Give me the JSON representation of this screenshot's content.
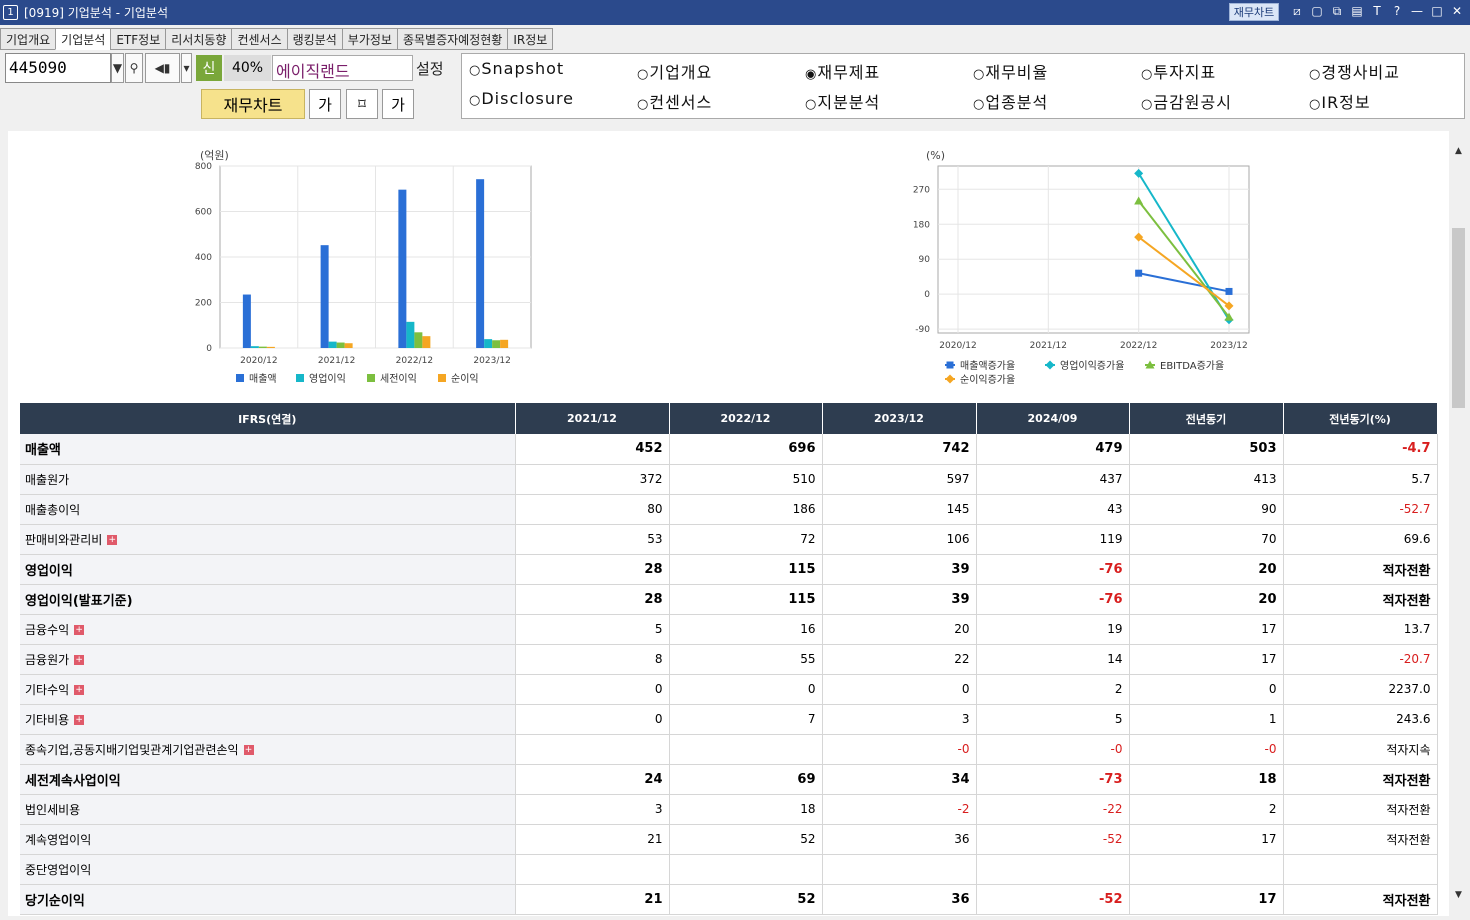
{
  "window": {
    "number": "1",
    "title": "[0919] 기업분석 - 기업분석",
    "fin_chart_btn": "재무차트"
  },
  "title_icons": [
    "chart-icon",
    "window-icon",
    "restore-icon",
    "tile-icon",
    "font-icon",
    "help-icon",
    "minimize-icon",
    "maximize-icon",
    "close-icon"
  ],
  "title_icon_glyphs": [
    "⧄",
    "▢",
    "⧉",
    "▤",
    "T",
    "?",
    "—",
    "□",
    "✕"
  ],
  "tabs": [
    "기업개요",
    "기업분석",
    "ETF정보",
    "리서치동향",
    "컨센서스",
    "랭킹분석",
    "부가정보",
    "종목별증자예정현황",
    "IR정보"
  ],
  "active_tab": 1,
  "toolbar": {
    "code": "445090",
    "new_label": "신",
    "percent": "40%",
    "company": "에이직랜드",
    "settings": "설정",
    "fin_chart": "재무차트",
    "btn_a": "가",
    "btn_b": "⌑",
    "btn_c": "가"
  },
  "radios": [
    [
      "Snapshot",
      "기업개요",
      "재무제표",
      "재무비율",
      "투자지표",
      "경쟁사비교"
    ],
    [
      "Disclosure",
      "컨센서스",
      "지분분석",
      "업종분석",
      "금감원공시",
      "IR정보"
    ]
  ],
  "selected_radio": "재무제표",
  "chart_data": [
    {
      "type": "bar",
      "title": "",
      "xlabel": "",
      "ylabel": "(억원)",
      "categories": [
        "2020/12",
        "2021/12",
        "2022/12",
        "2023/12"
      ],
      "ylim": [
        0,
        800
      ],
      "yticks": [
        0,
        200,
        400,
        600,
        800
      ],
      "series": [
        {
          "name": "매출액",
          "values": [
            235,
            452,
            696,
            742
          ]
        },
        {
          "name": "영업이익",
          "values": [
            8,
            28,
            115,
            39
          ]
        },
        {
          "name": "세전이익",
          "values": [
            6,
            24,
            69,
            34
          ]
        },
        {
          "name": "순이익",
          "values": [
            5,
            21,
            52,
            36
          ]
        }
      ],
      "colors": [
        "#2a6fd6",
        "#16b7c9",
        "#7cbf3f",
        "#f5a623"
      ],
      "legend": "bottom",
      "grid": true
    },
    {
      "type": "line",
      "title": "",
      "xlabel": "",
      "ylabel": "(%)",
      "categories": [
        "2020/12",
        "2021/12",
        "2022/12",
        "2023/12"
      ],
      "ylim": [
        -100,
        330
      ],
      "yticks": [
        -90,
        0,
        90,
        180,
        270
      ],
      "series": [
        {
          "name": "매출액증가율",
          "values": [
            null,
            null,
            54,
            7
          ]
        },
        {
          "name": "영업이익증가율",
          "values": [
            null,
            null,
            311,
            -66
          ]
        },
        {
          "name": "EBITDA증가율",
          "values": [
            null,
            null,
            240,
            -59
          ]
        },
        {
          "name": "순이익증가율",
          "values": [
            null,
            null,
            147,
            -30
          ]
        }
      ],
      "colors": [
        "#2a6fd6",
        "#16b7c9",
        "#7cbf3f",
        "#f5a623"
      ],
      "markers": [
        "square",
        "diamond",
        "triangle",
        "diamond"
      ],
      "legend": "bottom",
      "grid": true
    }
  ],
  "table": {
    "headers": [
      "IFRS(연결)",
      "2021/12",
      "2022/12",
      "2023/12",
      "2024/09",
      "전년동기",
      "전년동기(%)"
    ],
    "rows": [
      {
        "label": "매출액",
        "bold": true,
        "expand": false,
        "values": [
          "452",
          "696",
          "742",
          "479",
          "503",
          "-4.7"
        ]
      },
      {
        "label": "매출원가",
        "bold": false,
        "expand": false,
        "values": [
          "372",
          "510",
          "597",
          "437",
          "413",
          "5.7"
        ]
      },
      {
        "label": "매출총이익",
        "bold": false,
        "expand": false,
        "values": [
          "80",
          "186",
          "145",
          "43",
          "90",
          "-52.7"
        ]
      },
      {
        "label": "판매비와관리비",
        "bold": false,
        "expand": true,
        "values": [
          "53",
          "72",
          "106",
          "119",
          "70",
          "69.6"
        ]
      },
      {
        "label": "영업이익",
        "bold": true,
        "expand": false,
        "values": [
          "28",
          "115",
          "39",
          "-76",
          "20",
          "적자전환"
        ]
      },
      {
        "label": "영업이익(발표기준)",
        "bold": true,
        "expand": false,
        "values": [
          "28",
          "115",
          "39",
          "-76",
          "20",
          "적자전환"
        ]
      },
      {
        "label": "금융수익",
        "bold": false,
        "expand": true,
        "values": [
          "5",
          "16",
          "20",
          "19",
          "17",
          "13.7"
        ]
      },
      {
        "label": "금융원가",
        "bold": false,
        "expand": true,
        "values": [
          "8",
          "55",
          "22",
          "14",
          "17",
          "-20.7"
        ]
      },
      {
        "label": "기타수익",
        "bold": false,
        "expand": true,
        "values": [
          "0",
          "0",
          "0",
          "2",
          "0",
          "2237.0"
        ]
      },
      {
        "label": "기타비용",
        "bold": false,
        "expand": true,
        "values": [
          "0",
          "7",
          "3",
          "5",
          "1",
          "243.6"
        ]
      },
      {
        "label": "종속기업,공동지배기업및관계기업관련손익",
        "bold": false,
        "expand": true,
        "values": [
          "",
          "",
          "-0",
          "-0",
          "-0",
          "적자지속"
        ]
      },
      {
        "label": "세전계속사업이익",
        "bold": true,
        "expand": false,
        "values": [
          "24",
          "69",
          "34",
          "-73",
          "18",
          "적자전환"
        ]
      },
      {
        "label": "법인세비용",
        "bold": false,
        "expand": false,
        "values": [
          "3",
          "18",
          "-2",
          "-22",
          "2",
          "적자전환"
        ]
      },
      {
        "label": "계속영업이익",
        "bold": false,
        "expand": false,
        "values": [
          "21",
          "52",
          "36",
          "-52",
          "17",
          "적자전환"
        ]
      },
      {
        "label": "중단영업이익",
        "bold": false,
        "expand": false,
        "values": [
          "",
          "",
          "",
          "",
          "",
          ""
        ]
      },
      {
        "label": "당기순이익",
        "bold": true,
        "expand": false,
        "values": [
          "21",
          "52",
          "36",
          "-52",
          "17",
          "적자전환"
        ]
      }
    ]
  }
}
